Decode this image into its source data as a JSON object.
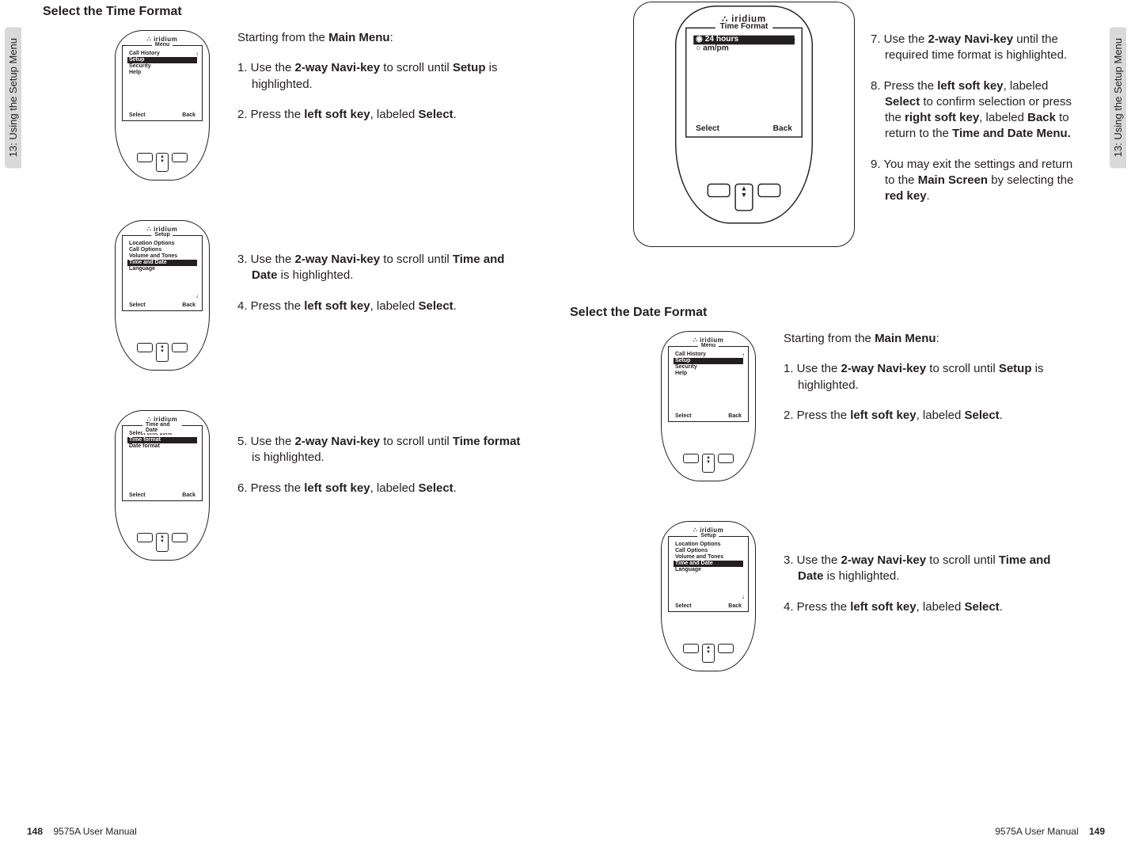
{
  "sideTab": "13: Using the Setup Menu",
  "pageLeft": {
    "number": "148",
    "manual": "9575A User Manual",
    "heading": "Select the Time Format",
    "block1": {
      "intro_a": "Starting from the ",
      "intro_b": "Main Menu",
      "intro_c": ":",
      "s1a": "1. Use the ",
      "s1b": "2-way Navi-key",
      "s1c": " to scroll until ",
      "s1d": "Setup",
      "s1e": " is highlighted.",
      "s2a": "2. Press the ",
      "s2b": "left soft key",
      "s2c": ", labeled ",
      "s2d": "Select",
      "s2e": ".",
      "screenTitle": "Menu",
      "items": [
        "Call History",
        "Setup",
        "Security",
        "Help"
      ],
      "softL": "Select",
      "softR": "Back"
    },
    "block2": {
      "s1a": "3. Use the ",
      "s1b": "2-way Navi-key",
      "s1c": " to scroll until ",
      "s1d": "Time and Date",
      "s1e": " is highlighted.",
      "s2a": "4. Press the ",
      "s2b": "left soft key",
      "s2c": ", labeled ",
      "s2d": "Select",
      "s2e": ".",
      "screenTitle": "Setup",
      "items": [
        "Location Options",
        "Call Options",
        "Volume and Tones",
        "Time and Date",
        "Language"
      ],
      "softL": "Select",
      "softR": "Back"
    },
    "block3": {
      "s1a": "5. Use the ",
      "s1b": "2-way Navi-key",
      "s1c": " to scroll until ",
      "s1d": "Time format",
      "s1e": " is highlighted.",
      "s2a": "6. Press the ",
      "s2b": "left soft key",
      "s2c": ", labeled ",
      "s2d": "Select",
      "s2e": ".",
      "screenTitle": "Time and Date",
      "items": [
        "Select time zone",
        "Time format",
        "Date format"
      ],
      "softL": "Select",
      "softR": "Back"
    }
  },
  "pageRight": {
    "number": "149",
    "manual": "9575A User Manual",
    "top": {
      "s7a": "7. Use the ",
      "s7b": "2-way Navi-key",
      "s7c": " until the required time format is highlighted.",
      "s8a": "8. Press the ",
      "s8b": "left soft key",
      "s8c": ", labeled ",
      "s8d": "Select",
      "s8e": " to confirm selection or press the ",
      "s8f": "right soft key",
      "s8g": ", labeled ",
      "s8h": "Back",
      "s8i": " to return to the ",
      "s8j": "Time and Date Menu.",
      "s9a": "9. You may exit the settings and return to the ",
      "s9b": "Main Screen",
      "s9c": " by selecting the ",
      "s9d": "red key",
      "s9e": ".",
      "screenTitle": "Time Format",
      "opt1": "24 hours",
      "opt2": "am/pm",
      "softL": "Select",
      "softR": "Back"
    },
    "heading": "Select the Date Format",
    "block1": {
      "intro_a": "Starting from the ",
      "intro_b": "Main Menu",
      "intro_c": ":",
      "s1a": "1. Use the ",
      "s1b": "2-way Navi-key",
      "s1c": " to scroll until ",
      "s1d": "Setup",
      "s1e": " is highlighted.",
      "s2a": "2. Press the ",
      "s2b": "left soft key",
      "s2c": ", labeled ",
      "s2d": "Select",
      "s2e": ".",
      "screenTitle": "Menu",
      "items": [
        "Call History",
        "Setup",
        "Security",
        "Help"
      ],
      "softL": "Select",
      "softR": "Back"
    },
    "block2": {
      "s1a": "3. Use the ",
      "s1b": "2-way Navi-key",
      "s1c": " to scroll until ",
      "s1d": "Time and Date",
      "s1e": " is highlighted.",
      "s2a": "4. Press the ",
      "s2b": "left soft key",
      "s2c": ", labeled ",
      "s2d": "Select",
      "s2e": ".",
      "screenTitle": "Setup",
      "items": [
        "Location Options",
        "Call Options",
        "Volume and Tones",
        "Time and Date",
        "Language"
      ],
      "softL": "Select",
      "softR": "Back"
    }
  }
}
